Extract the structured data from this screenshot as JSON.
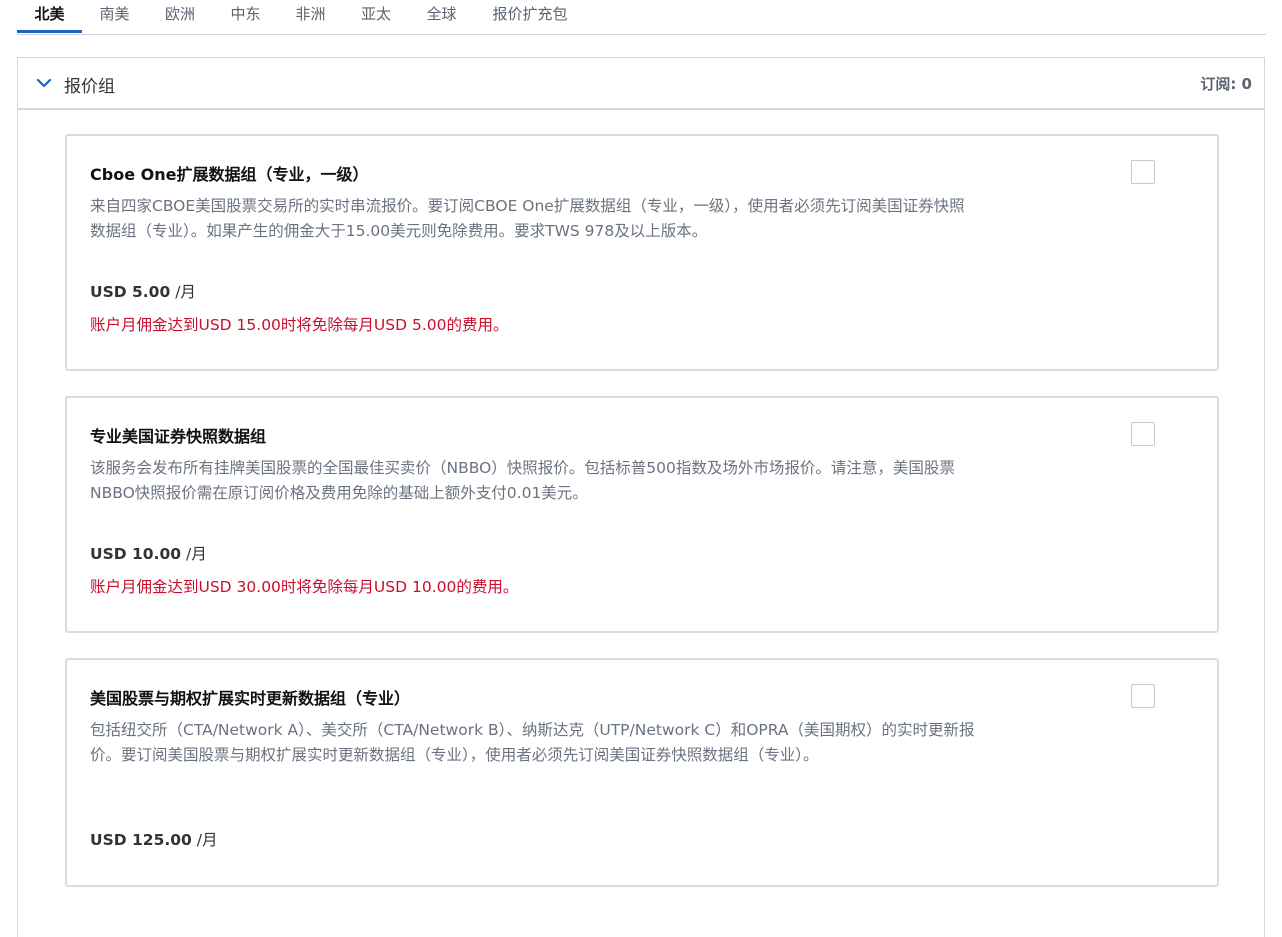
{
  "tabs": [
    "北美",
    "南美",
    "欧洲",
    "中东",
    "非洲",
    "亚太",
    "全球",
    "报价扩充包"
  ],
  "panel": {
    "title": "报价组",
    "subscribed_label": "订阅: 0"
  },
  "cards": [
    {
      "title": "Cboe One扩展数据组（专业，一级）",
      "description": "来自四家CBOE美国股票交易所的实时串流报价。要订阅CBOE One扩展数据组（专业，一级），使用者必须先订阅美国证券快照数据组（专业）。如果产生的佣金大于15.00美元则免除费用。要求TWS 978及以上版本。",
      "price": "USD 5.00",
      "price_unit": "/月",
      "waiver": "账户月佣金达到USD 15.00时将免除每月USD 5.00的费用。"
    },
    {
      "title": "专业美国证券快照数据组",
      "description": "该服务会发布所有挂牌美国股票的全国最佳买卖价（NBBO）快照报价。包括标普500指数及场外市场报价。请注意，美国股票NBBO快照报价需在原订阅价格及费用免除的基础上额外支付0.01美元。",
      "price": "USD 10.00",
      "price_unit": "/月",
      "waiver": "账户月佣金达到USD 30.00时将免除每月USD 10.00的费用。"
    },
    {
      "title": "美国股票与期权扩展实时更新数据组（专业）",
      "description": "包括纽交所（CTA/Network A）、美交所（CTA/Network B）、纳斯达克（UTP/Network C）和OPRA（美国期权）的实时更新报价。要订阅美国股票与期权扩展实时更新数据组（专业），使用者必须先订阅美国证券快照数据组（专业）。",
      "price": "USD 125.00",
      "price_unit": "/月"
    }
  ],
  "colors": {
    "accent": "#1e63c4",
    "warning_text": "#c8102e",
    "muted_text": "#6b7380"
  },
  "icons": {
    "collapse": "chevron-down-icon"
  }
}
